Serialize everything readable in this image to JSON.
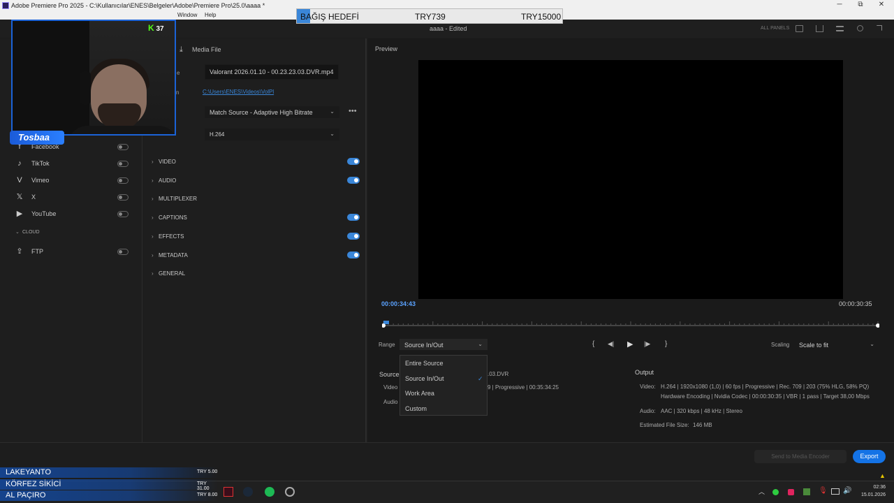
{
  "window": {
    "title": "Adobe Premiere Pro 2025 - C:\\Kullanıcılar\\ENES\\Belgeler\\Adobe\\Premiere Pro\\25.0\\aaaa *",
    "minimize": "─",
    "restore": "⧉",
    "close": "✕"
  },
  "menu": {
    "window": "Window",
    "help": "Help"
  },
  "header": {
    "project_title": "aaaa - Edited",
    "all_panels": "ALL PANELS"
  },
  "donation_goal": {
    "label": "BAĞIŞ HEDEFİ",
    "current": "TRY739",
    "target": "TRY15000",
    "progress": 0.049
  },
  "stream": {
    "viewer_count": "37",
    "streamer_name": "Tosbaa"
  },
  "left_panel": {
    "destinations": [
      {
        "label": "Facebook",
        "icon": "facebook-icon",
        "glyph": "f"
      },
      {
        "label": "TikTok",
        "icon": "tiktok-icon",
        "glyph": "♪"
      },
      {
        "label": "Vimeo",
        "icon": "vimeo-icon",
        "glyph": "V"
      },
      {
        "label": "X",
        "icon": "x-icon",
        "glyph": "𝕏"
      },
      {
        "label": "YouTube",
        "icon": "youtube-icon",
        "glyph": "▶"
      }
    ],
    "cloud_section": "CLOUD",
    "ftp": {
      "label": "FTP",
      "icon": "upload-icon",
      "glyph": "⇪"
    }
  },
  "settings": {
    "media_file_label": "Media File",
    "file_name": "Valorant 2026.01.10 - 00.23.23.03.DVR.mp4",
    "file_name_label": "e",
    "location_label": "n",
    "location": "C:\\Users\\ENES\\Videos\\VolPl",
    "preset": "Match Source - Adaptive High Bitrate",
    "format": "H.264",
    "sections": [
      "VIDEO",
      "AUDIO",
      "MULTIPLEXER",
      "CAPTIONS",
      "EFFECTS",
      "METADATA",
      "GENERAL"
    ],
    "toggles_on": [
      "VIDEO",
      "AUDIO",
      "CAPTIONS",
      "EFFECTS",
      "METADATA"
    ]
  },
  "preview": {
    "label": "Preview",
    "timecode_in": "00:00:34:43",
    "timecode_out": "00:00:30:35",
    "range_label": "Range",
    "range_value": "Source In/Out",
    "range_options": [
      "Entire Source",
      "Source In/Out",
      "Work Area",
      "Custom"
    ],
    "range_selected": "Source In/Out",
    "scaling_label": "Scaling",
    "scaling_value": "Scale to fit",
    "transport": {
      "mark_in": "{",
      "step_back": "◀|",
      "play": "▶",
      "step_forward": "|▶",
      "mark_out": "}"
    }
  },
  "source_summary": {
    "label": "Source",
    "filename_tail": ".03.DVR",
    "video_label": "Video",
    "audio_label": "Audio",
    "video_info_tail": "9  |  Progressive  |  00:35:34:25"
  },
  "output_summary": {
    "label": "Output",
    "video_label": "Video:",
    "video_line1": "H.264  |  1920x1080 (1,0)  |  60 fps  |  Progressive  |  Rec. 709  |  203 (75% HLG, 58% PQ)",
    "video_line2": "Hardware Encoding  |  Nvidia Codec  |  00:00:30:35  |  VBR  |  1 pass  |  Target 38,00 Mbps",
    "audio_label": "Audio:",
    "audio_line": "AAC  |  320 kbps  |  48 kHz  |  Stereo",
    "file_size_label": "Estimated File Size:",
    "file_size": "146 MB"
  },
  "footer": {
    "send_label": "Send to Media Encoder",
    "export_label": "Export"
  },
  "donors": [
    {
      "name": "LAKEYANTO",
      "amount": "TRY 5.00"
    },
    {
      "name": "KÖRFEZ SİKİCİ",
      "amount": "TRY 31.00"
    },
    {
      "name": "AL PAÇIRO",
      "amount": "TRY 8.00"
    }
  ],
  "taskbar": {
    "time": "02:36",
    "date": "15.01.2026"
  },
  "colors": {
    "accent": "#1473e6",
    "toggle_on": "#3a86d8",
    "timecode": "#5aa2ff",
    "kick_green": "#53fc18"
  }
}
